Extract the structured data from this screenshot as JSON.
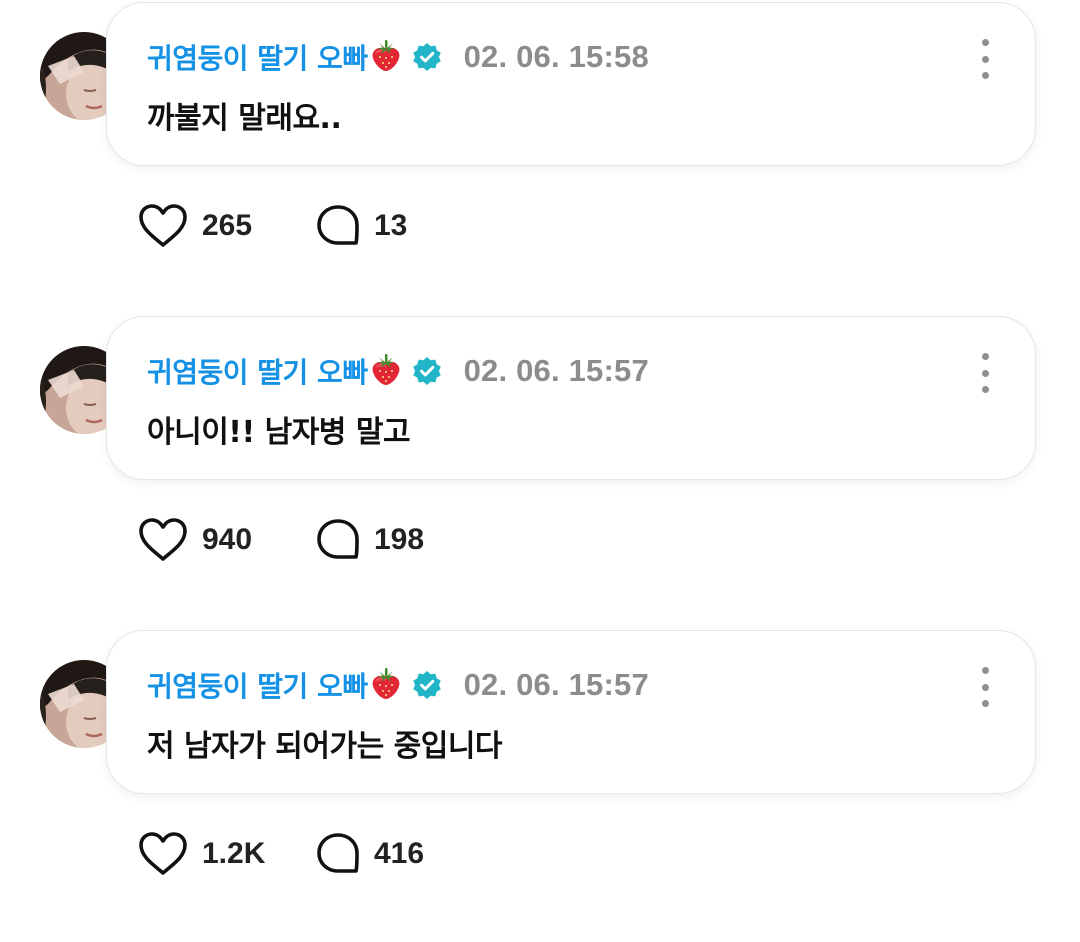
{
  "posts": [
    {
      "author": "귀염둥이 딸기 오빠",
      "author_emoji": "strawberry-emoji",
      "verified_badge": "verified-badge-icon",
      "timestamp": "02. 06. 15:58",
      "message": "까불지 말래요..",
      "likes": "265",
      "comments": "13"
    },
    {
      "author": "귀염둥이 딸기 오빠",
      "author_emoji": "strawberry-emoji",
      "verified_badge": "verified-badge-icon",
      "timestamp": "02. 06. 15:57",
      "message": "아니이!! 남자병 말고",
      "likes": "940",
      "comments": "198"
    },
    {
      "author": "귀염둥이 딸기 오빠",
      "author_emoji": "strawberry-emoji",
      "verified_badge": "verified-badge-icon",
      "timestamp": "02. 06. 15:57",
      "message": "저 남자가 되어가는 중입니다",
      "likes": "1.2K",
      "comments": "416"
    }
  ],
  "colors": {
    "author_name": "#1592e6",
    "verified_badge": "#22b5c8",
    "timestamp": "#8c8c8c",
    "message_text": "#111111"
  },
  "icons": {
    "like": "heart-outline-icon",
    "comment": "speech-bubble-outline-icon",
    "more": "vertical-dots-icon"
  }
}
